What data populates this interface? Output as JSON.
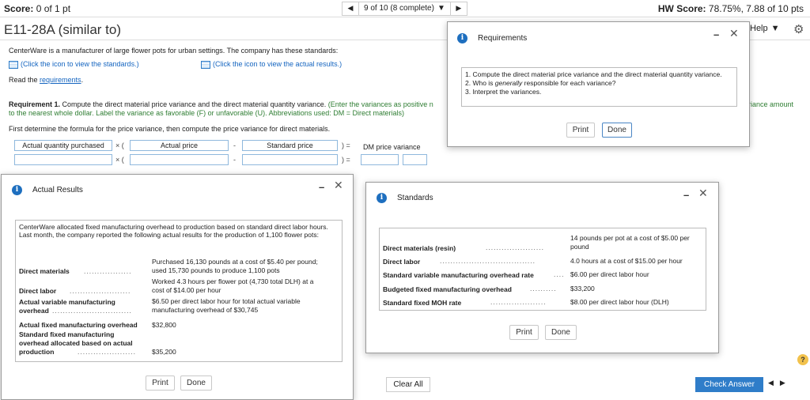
{
  "top": {
    "score_label": "Score:",
    "score_value": "0 of 1 pt",
    "question_nav": "9 of 10 (8 complete)",
    "hw_label": "HW Score:",
    "hw_value": "78.75%, 7.88 of 10 pts"
  },
  "title": "E11-28A (similar to)",
  "help_label": "Help",
  "intro": {
    "line1": "CenterWare is a manufacturer of large flower pots for urban settings. The company has these standards:",
    "link_standards": "(Click the icon to view the standards.)",
    "link_results": "(Click the icon to view the actual results.)",
    "read_prefix": "Read the ",
    "read_link": "requirements",
    "read_suffix": ".",
    "req_label": "Requirement 1.",
    "req_text": " Compute the direct material price variance and the direct material quantity variance.",
    "req_hint_a": "(Enter the variances as positive n",
    "req_hint_b": "to the nearest whole dollar. Label the variance as favorable (F) or unfavorable (U). Abbreviations used: DM = Direct materials)",
    "req_hint_right": "riance amount",
    "first_line": "First determine the formula for the price variance, then compute the price variance for direct materials."
  },
  "formula": {
    "box1": "Actual quantity purchased",
    "box2": "Actual price",
    "box3": "Standard price",
    "result": "DM price variance",
    "times_open": "× (",
    "minus": "-",
    "close_eq": ") ="
  },
  "requirements_dialog": {
    "title": "Requirements",
    "item1": "1. Compute the direct material price variance and the direct material quantity variance.",
    "item2_a": "2. Who is ",
    "item2_b": "generally",
    "item2_c": " responsible for each variance?",
    "item3": "3. Interpret the variances.",
    "print": "Print",
    "done": "Done"
  },
  "actual_dialog": {
    "title": "Actual Results",
    "intro": "CenterWare allocated fixed manufacturing overhead to production based on standard direct labor hours. Last month, the company reported the following actual results for the production of 1,100 flower pots:",
    "rows": {
      "dm_label": "Direct materials",
      "dm_value_1": "Purchased 16,130 pounds at a cost of $5.40 per pound;",
      "dm_value_2": "used 15,730 pounds to produce 1,100 pots",
      "dl_label": "Direct labor",
      "dl_value_1": "Worked 4.3 hours per flower pot (4,730 total DLH) at a",
      "dl_value_2": "cost of $14.00 per hour",
      "avm_label_1": "Actual variable manufacturing",
      "avm_label_2": "overhead",
      "avm_value_1": "$6.50 per direct labor hour for total actual variable",
      "avm_value_2": "manufacturing overhead of $30,745",
      "afm_label": "Actual fixed manufacturing overhead",
      "afm_value": "$32,800",
      "sfm_label_1": "Standard fixed manufacturing",
      "sfm_label_2": "overhead allocated based on actual",
      "sfm_label_3": "production",
      "sfm_value": "$35,200"
    },
    "print": "Print",
    "done": "Done"
  },
  "standards_dialog": {
    "title": "Standards",
    "rows": {
      "dm_label": "Direct materials (resin)",
      "dm_value_1": "14 pounds per pot at a cost of $5.00 per",
      "dm_value_2": "pound",
      "dl_label": "Direct labor",
      "dl_value": "4.0 hours at a cost of $15.00 per hour",
      "svm_label": "Standard variable manufacturing overhead rate",
      "svm_value": "$6.00 per direct labor hour",
      "bfm_label": "Budgeted fixed manufacturing overhead",
      "bfm_value": "$33,200",
      "sfm_label": "Standard fixed MOH rate",
      "sfm_value": "$8.00 per direct labor hour (DLH)"
    },
    "print": "Print",
    "done": "Done"
  },
  "bottom": {
    "clear_all": "Clear All",
    "check_answer": "Check Answer"
  },
  "colors": {
    "accent": "#2f7dc9",
    "info_icon": "#1e6fbf",
    "hint_green": "#2e7d32"
  }
}
